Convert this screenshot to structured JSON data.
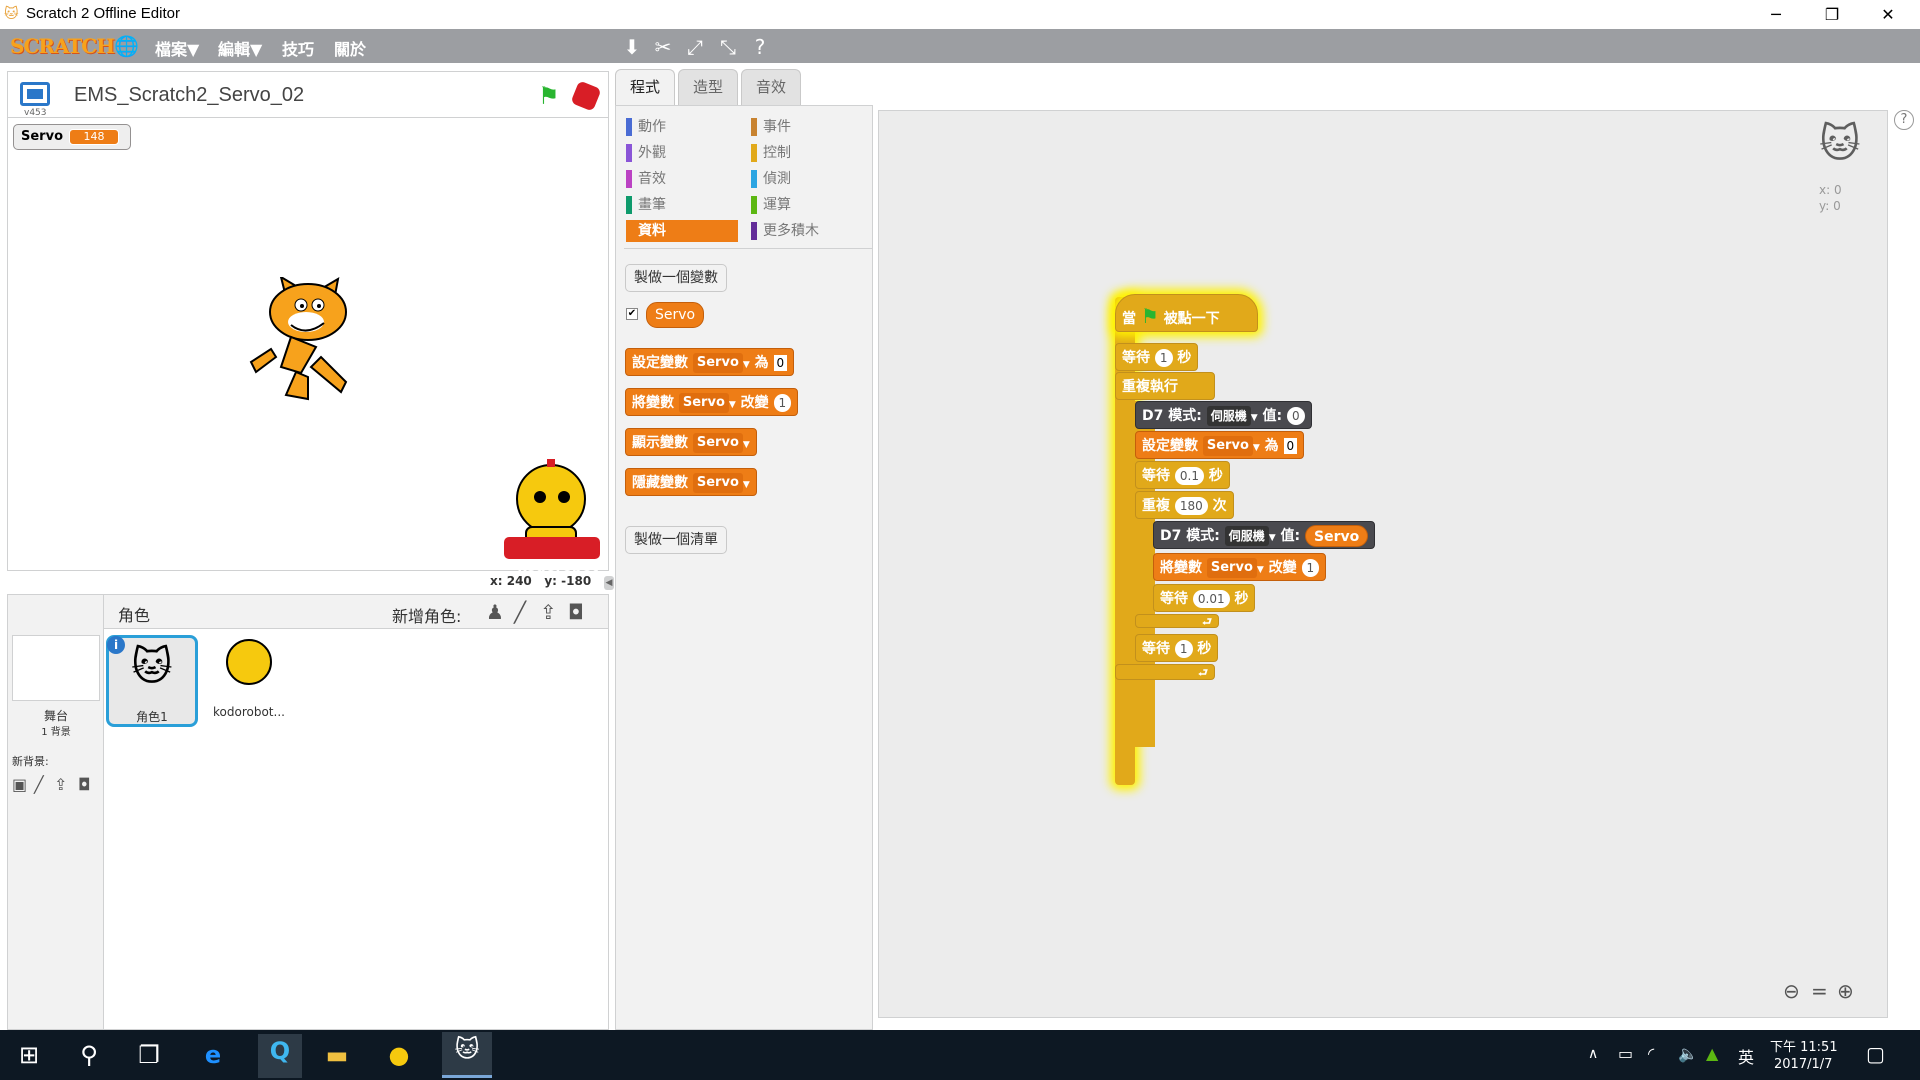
{
  "window": {
    "title": "Scratch 2 Offline Editor",
    "minimize": "─",
    "maximize": "❐",
    "close": "✕"
  },
  "menubar": {
    "logo": "SCRATCH",
    "items": [
      "檔案▼",
      "編輯▼",
      "技巧",
      "關於"
    ]
  },
  "stage": {
    "project_name": "EMS_Scratch2_Servo_02",
    "version": "v453",
    "variable_monitor": {
      "name": "Servo",
      "value": "148"
    },
    "coords": {
      "x_label": "x:",
      "x": "240",
      "y_label": "y:",
      "y": "-180"
    },
    "sprite_text": "kodorobot"
  },
  "sprites": {
    "header_label": "角色",
    "new_sprite_label": "新增角色:",
    "stage_name": "舞台",
    "stage_backdrops": "1 背景",
    "new_backdrop_label": "新背景:",
    "list": [
      {
        "name": "角色1"
      },
      {
        "name": "kodorobot..."
      }
    ]
  },
  "tabs": [
    "程式",
    "造型",
    "音效"
  ],
  "categories": [
    {
      "label": "動作",
      "color": "#4a6cd4"
    },
    {
      "label": "事件",
      "color": "#c88330"
    },
    {
      "label": "外觀",
      "color": "#8a55d7"
    },
    {
      "label": "控制",
      "color": "#e1a91a"
    },
    {
      "label": "音效",
      "color": "#bb42c3"
    },
    {
      "label": "偵測",
      "color": "#2ca5e2"
    },
    {
      "label": "畫筆",
      "color": "#0e9a6c"
    },
    {
      "label": "運算",
      "color": "#5cb712"
    },
    {
      "label": "資料",
      "color": "#ee7d16"
    },
    {
      "label": "更多積木",
      "color": "#632d99"
    }
  ],
  "palette": {
    "make_variable": "製做一個變數",
    "variable_name": "Servo",
    "set_block": {
      "label": "設定變數",
      "var": "Servo",
      "to": "為",
      "value": "0"
    },
    "change_block": {
      "label": "將變數",
      "var": "Servo",
      "by": "改變",
      "value": "1"
    },
    "show_block": {
      "label": "顯示變數",
      "var": "Servo"
    },
    "hide_block": {
      "label": "隱藏變數",
      "var": "Servo"
    },
    "make_list": "製做一個清單"
  },
  "script": {
    "hat": {
      "pre": "當",
      "post": "被點一下"
    },
    "wait1": {
      "label": "等待",
      "value": "1",
      "unit": "秒"
    },
    "forever": "重複執行",
    "d7_a": {
      "pin": "D7",
      "mode_label": "模式:",
      "mode": "伺服機",
      "val_label": "值:",
      "value": "0"
    },
    "set": {
      "label": "設定變數",
      "var": "Servo",
      "to": "為",
      "value": "0"
    },
    "wait2": {
      "label": "等待",
      "value": "0.1",
      "unit": "秒"
    },
    "repeat": {
      "label": "重複",
      "value": "180",
      "unit": "次"
    },
    "d7_b": {
      "pin": "D7",
      "mode_label": "模式:",
      "mode": "伺服機",
      "val_label": "值:",
      "value": "Servo"
    },
    "change": {
      "label": "將變數",
      "var": "Servo",
      "by": "改變",
      "value": "1"
    },
    "wait3": {
      "label": "等待",
      "value": "0.01",
      "unit": "秒"
    },
    "wait4": {
      "label": "等待",
      "value": "1",
      "unit": "秒"
    }
  },
  "sprite_info": {
    "x": "x: 0",
    "y": "y: 0"
  },
  "taskbar": {
    "time": "下午 11:51",
    "date": "2017/1/7",
    "ime": "英"
  }
}
